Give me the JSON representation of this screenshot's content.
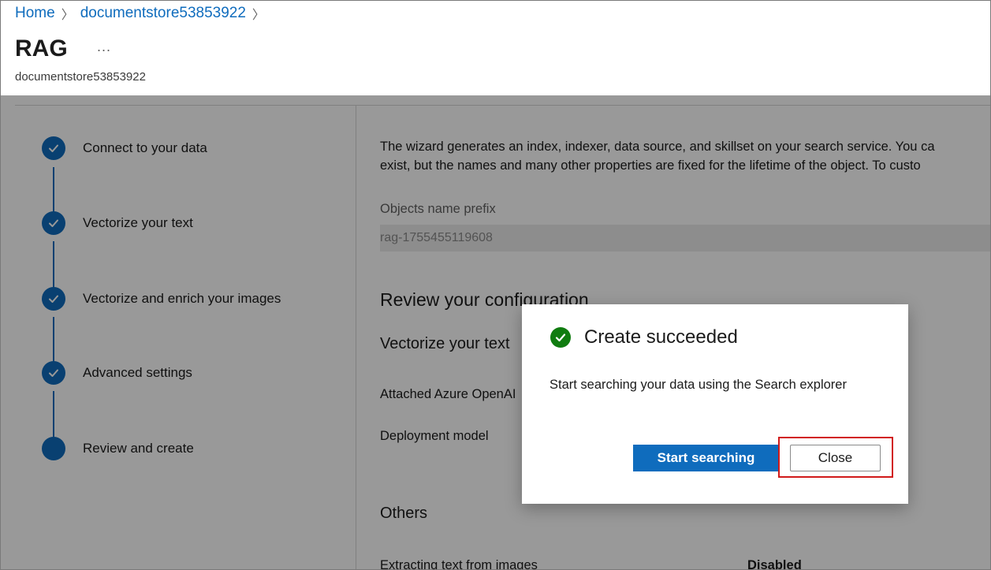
{
  "breadcrumb": {
    "home": "Home",
    "store": "documentstore53853922",
    "separator": ">"
  },
  "header": {
    "title": "RAG",
    "more": "...",
    "subtitle": "documentstore53853922"
  },
  "steps": [
    {
      "label": "Connect to your data",
      "status": "complete"
    },
    {
      "label": "Vectorize your text",
      "status": "complete"
    },
    {
      "label": "Vectorize and enrich your images",
      "status": "complete"
    },
    {
      "label": "Advanced settings",
      "status": "complete"
    },
    {
      "label": "Review and create",
      "status": "current"
    }
  ],
  "content": {
    "description_line1": "The wizard generates an index, indexer, data source, and skillset on your search service. You ca",
    "description_line2": "exist, but the names and many other properties are fixed for the lifetime of the object. To custo",
    "prefix_label": "Objects name prefix",
    "prefix_value": "rag-1755455119608",
    "review_title": "Review your configuration",
    "vectorize_title": "Vectorize your text",
    "attached_label": "Attached Azure OpenAI",
    "deployment_label": "Deployment model",
    "others_title": "Others",
    "extracting_label": "Extracting text from images",
    "extracting_value": "Disabled"
  },
  "dialog": {
    "title": "Create succeeded",
    "message": "Start searching your data using the Search explorer",
    "primary_button": "Start searching",
    "secondary_button": "Close"
  },
  "colors": {
    "accent": "#0f6cbd",
    "success": "#107c10",
    "highlight": "#d11a1a"
  }
}
